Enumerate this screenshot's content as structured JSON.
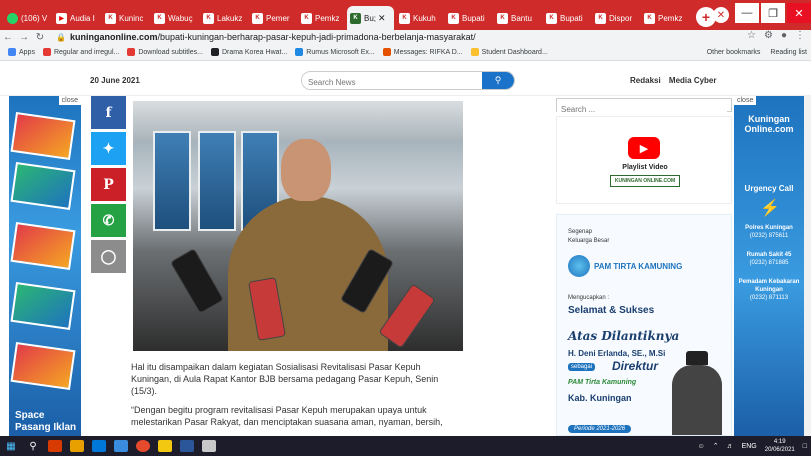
{
  "browser": {
    "tabs": [
      {
        "label": "(106) V",
        "icon": "whatsapp-icon"
      },
      {
        "label": "Audia I",
        "icon": "youtube-icon"
      },
      {
        "label": "Kuninc",
        "icon": "kuningan-online-icon"
      },
      {
        "label": "Wabuç",
        "icon": "kuningan-online-icon"
      },
      {
        "label": "Lakukz",
        "icon": "kuningan-online-icon"
      },
      {
        "label": "Pemer",
        "icon": "kuningan-online-icon"
      },
      {
        "label": "Pemkz",
        "icon": "kuningan-online-icon"
      },
      {
        "label": "Bu;",
        "icon": "kuningan-online-icon",
        "active": true
      },
      {
        "label": "Kukuh",
        "icon": "kuningan-online-icon"
      },
      {
        "label": "Bupati",
        "icon": "kuningan-online-icon"
      },
      {
        "label": "Bantu",
        "icon": "kuningan-online-icon"
      },
      {
        "label": "Bupati",
        "icon": "kuningan-online-icon"
      },
      {
        "label": "Dispor",
        "icon": "kuningan-online-icon"
      },
      {
        "label": "Pemkz",
        "icon": "kuningan-online-icon"
      }
    ],
    "url_domain": "kuninganonline.com",
    "url_path": "/bupati-kuningan-berharap-pasar-kepuh-jadi-primadona-berbelanja-masyarakat/",
    "bookmarks": [
      "Apps",
      "Regular and irregul...",
      "Download subtitles...",
      "Drama Korea Hwat...",
      "Rumus Microsoft Ex...",
      "Messages: RIFKA D...",
      "Student Dashboard..."
    ],
    "other_bookmarks": "Other bookmarks",
    "reading_list": "Reading list"
  },
  "site": {
    "date": "20 June 2021",
    "search_placeholder": "Search News",
    "header_links": [
      "Redaksi",
      "Media Cyber"
    ]
  },
  "ad_left": {
    "close": "close",
    "label_line1": "Space",
    "label_line2": "Pasang Iklan"
  },
  "article": {
    "paragraph1": "Hal itu disampaikan dalam kegiatan Sosialisasi Revitalisasi Pasar Kepuh Kuningan, di Aula Rapat Kantor BJB bersama pedagang Pasar Kepuh, Senin (15/3).",
    "paragraph2": "“Dengan begitu program revitalisasi Pasar Kepuh merupakan upaya untuk melestarikan Pasar Rakyat, dan menciptakan suasana aman, nyaman, bersih,"
  },
  "sidebar": {
    "search_placeholder": "Search ...",
    "playlist_label": "Playlist Video",
    "playlist_logo": "KUNINGAN ONLINE.COM",
    "congrats": {
      "line1": "Segenap",
      "line2": "Keluarga Besar",
      "org": "PAM TIRTA KAMUNING",
      "mengucapkan": "Mengucapkan :",
      "selamat": "Selamat & Sukses",
      "atas": "Atas Dilantiknya",
      "name": "H. Deni Erlanda, SE., M.Si",
      "sebagai": "sebagai",
      "direktur": "Direktur",
      "pam_line": "PAM Tirta Kamuning",
      "kab": "Kab. Kuningan",
      "periode": "Periode 2021-2026"
    }
  },
  "ad_right": {
    "close": "close",
    "brand_line1": "Kuningan",
    "brand_line2": "Online.com",
    "urgency_title": "Urgency Call",
    "entries": [
      {
        "name": "Polres Kuningan",
        "phone": "(0232) 875611"
      },
      {
        "name": "Rumah Sakit 45",
        "phone": "(0232) 871885"
      },
      {
        "name": "Pemadam Kebakaran Kuningan",
        "phone": "(0232) 871113"
      }
    ]
  },
  "taskbar": {
    "time": "4:19",
    "date": "20/06/2021",
    "lang": "ENG"
  }
}
